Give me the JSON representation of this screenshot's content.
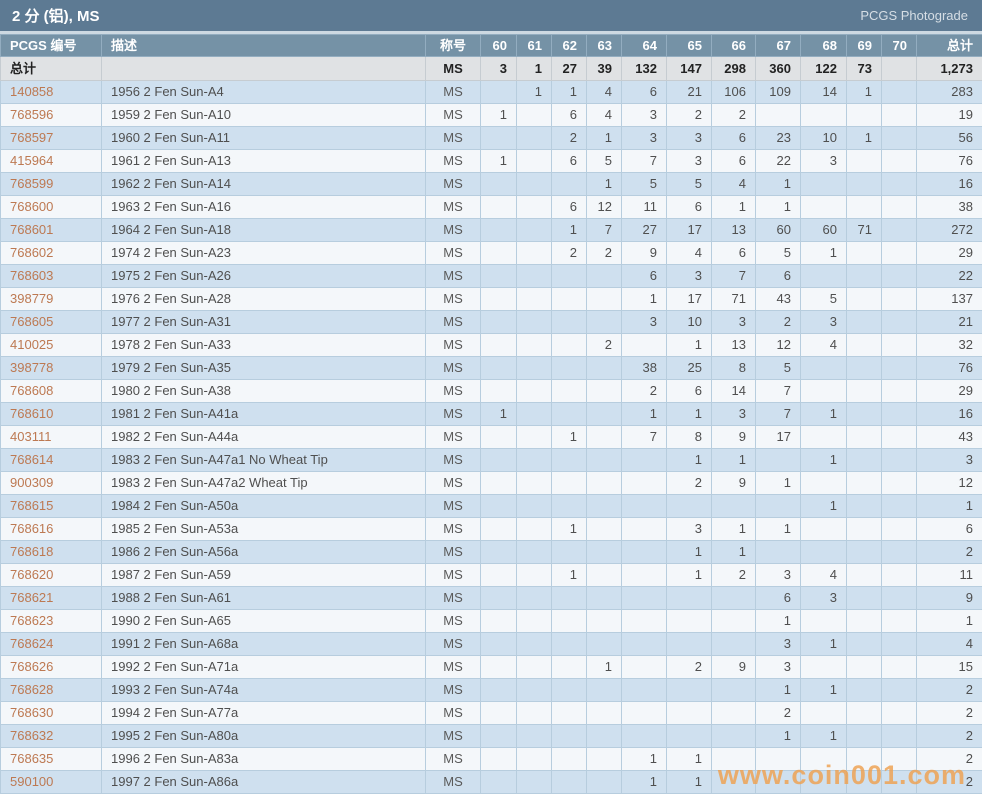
{
  "title_bar": {
    "title": "2 分 (铝), MS",
    "brand": "PCGS Photograde"
  },
  "table": {
    "headers": {
      "id": "PCGS 编号",
      "description": "描述",
      "designation": "称号",
      "grades": [
        "60",
        "61",
        "62",
        "63",
        "64",
        "65",
        "66",
        "67",
        "68",
        "69",
        "70"
      ],
      "total": "总计"
    },
    "totals_row": {
      "label": "总计",
      "designation": "MS",
      "values": [
        "3",
        "1",
        "27",
        "39",
        "132",
        "147",
        "298",
        "360",
        "122",
        "73",
        ""
      ],
      "total": "1,273"
    },
    "rows": [
      {
        "id": "140858",
        "description": "1956 2 Fen Sun-A4",
        "designation": "MS",
        "values": [
          "",
          "1",
          "1",
          "4",
          "6",
          "21",
          "106",
          "109",
          "14",
          "1",
          ""
        ],
        "total": "283"
      },
      {
        "id": "768596",
        "description": "1959 2 Fen Sun-A10",
        "designation": "MS",
        "values": [
          "1",
          "",
          "6",
          "4",
          "3",
          "2",
          "2",
          "",
          "",
          "",
          ""
        ],
        "total": "19"
      },
      {
        "id": "768597",
        "description": "1960 2 Fen Sun-A11",
        "designation": "MS",
        "values": [
          "",
          "",
          "2",
          "1",
          "3",
          "3",
          "6",
          "23",
          "10",
          "1",
          ""
        ],
        "total": "56"
      },
      {
        "id": "415964",
        "description": "1961 2 Fen Sun-A13",
        "designation": "MS",
        "values": [
          "1",
          "",
          "6",
          "5",
          "7",
          "3",
          "6",
          "22",
          "3",
          "",
          ""
        ],
        "total": "76"
      },
      {
        "id": "768599",
        "description": "1962 2 Fen Sun-A14",
        "designation": "MS",
        "values": [
          "",
          "",
          "",
          "1",
          "5",
          "5",
          "4",
          "1",
          "",
          "",
          ""
        ],
        "total": "16"
      },
      {
        "id": "768600",
        "description": "1963 2 Fen Sun-A16",
        "designation": "MS",
        "values": [
          "",
          "",
          "6",
          "12",
          "11",
          "6",
          "1",
          "1",
          "",
          "",
          ""
        ],
        "total": "38"
      },
      {
        "id": "768601",
        "description": "1964 2 Fen Sun-A18",
        "designation": "MS",
        "values": [
          "",
          "",
          "1",
          "7",
          "27",
          "17",
          "13",
          "60",
          "60",
          "71",
          ""
        ],
        "total": "272"
      },
      {
        "id": "768602",
        "description": "1974 2 Fen Sun-A23",
        "designation": "MS",
        "values": [
          "",
          "",
          "2",
          "2",
          "9",
          "4",
          "6",
          "5",
          "1",
          "",
          ""
        ],
        "total": "29"
      },
      {
        "id": "768603",
        "description": "1975 2 Fen Sun-A26",
        "designation": "MS",
        "values": [
          "",
          "",
          "",
          "",
          "6",
          "3",
          "7",
          "6",
          "",
          "",
          ""
        ],
        "total": "22"
      },
      {
        "id": "398779",
        "description": "1976 2 Fen Sun-A28",
        "designation": "MS",
        "values": [
          "",
          "",
          "",
          "",
          "1",
          "17",
          "71",
          "43",
          "5",
          "",
          ""
        ],
        "total": "137"
      },
      {
        "id": "768605",
        "description": "1977 2 Fen Sun-A31",
        "designation": "MS",
        "values": [
          "",
          "",
          "",
          "",
          "3",
          "10",
          "3",
          "2",
          "3",
          "",
          ""
        ],
        "total": "21"
      },
      {
        "id": "410025",
        "description": "1978 2 Fen Sun-A33",
        "designation": "MS",
        "values": [
          "",
          "",
          "",
          "2",
          "",
          "1",
          "13",
          "12",
          "4",
          "",
          ""
        ],
        "total": "32"
      },
      {
        "id": "398778",
        "description": "1979 2 Fen Sun-A35",
        "designation": "MS",
        "values": [
          "",
          "",
          "",
          "",
          "38",
          "25",
          "8",
          "5",
          "",
          "",
          ""
        ],
        "total": "76"
      },
      {
        "id": "768608",
        "description": "1980 2 Fen Sun-A38",
        "designation": "MS",
        "values": [
          "",
          "",
          "",
          "",
          "2",
          "6",
          "14",
          "7",
          "",
          "",
          ""
        ],
        "total": "29"
      },
      {
        "id": "768610",
        "description": "1981 2 Fen Sun-A41a",
        "designation": "MS",
        "values": [
          "1",
          "",
          "",
          "",
          "1",
          "1",
          "3",
          "7",
          "1",
          "",
          ""
        ],
        "total": "16"
      },
      {
        "id": "403111",
        "description": "1982 2 Fen Sun-A44a",
        "designation": "MS",
        "values": [
          "",
          "",
          "1",
          "",
          "7",
          "8",
          "9",
          "17",
          "",
          "",
          ""
        ],
        "total": "43"
      },
      {
        "id": "768614",
        "description": "1983 2 Fen Sun-A47a1 No Wheat Tip",
        "designation": "MS",
        "values": [
          "",
          "",
          "",
          "",
          "",
          "1",
          "1",
          "",
          "1",
          "",
          ""
        ],
        "total": "3"
      },
      {
        "id": "900309",
        "description": "1983 2 Fen Sun-A47a2 Wheat Tip",
        "designation": "MS",
        "values": [
          "",
          "",
          "",
          "",
          "",
          "2",
          "9",
          "1",
          "",
          "",
          ""
        ],
        "total": "12"
      },
      {
        "id": "768615",
        "description": "1984 2 Fen Sun-A50a",
        "designation": "MS",
        "values": [
          "",
          "",
          "",
          "",
          "",
          "",
          "",
          "",
          "1",
          "",
          ""
        ],
        "total": "1"
      },
      {
        "id": "768616",
        "description": "1985 2 Fen Sun-A53a",
        "designation": "MS",
        "values": [
          "",
          "",
          "1",
          "",
          "",
          "3",
          "1",
          "1",
          "",
          "",
          ""
        ],
        "total": "6"
      },
      {
        "id": "768618",
        "description": "1986 2 Fen Sun-A56a",
        "designation": "MS",
        "values": [
          "",
          "",
          "",
          "",
          "",
          "1",
          "1",
          "",
          "",
          "",
          ""
        ],
        "total": "2"
      },
      {
        "id": "768620",
        "description": "1987 2 Fen Sun-A59",
        "designation": "MS",
        "values": [
          "",
          "",
          "1",
          "",
          "",
          "1",
          "2",
          "3",
          "4",
          "",
          ""
        ],
        "total": "11"
      },
      {
        "id": "768621",
        "description": "1988 2 Fen Sun-A61",
        "designation": "MS",
        "values": [
          "",
          "",
          "",
          "",
          "",
          "",
          "",
          "6",
          "3",
          "",
          ""
        ],
        "total": "9"
      },
      {
        "id": "768623",
        "description": "1990 2 Fen Sun-A65",
        "designation": "MS",
        "values": [
          "",
          "",
          "",
          "",
          "",
          "",
          "",
          "1",
          "",
          "",
          ""
        ],
        "total": "1"
      },
      {
        "id": "768624",
        "description": "1991 2 Fen Sun-A68a",
        "designation": "MS",
        "values": [
          "",
          "",
          "",
          "",
          "",
          "",
          "",
          "3",
          "1",
          "",
          ""
        ],
        "total": "4"
      },
      {
        "id": "768626",
        "description": "1992 2 Fen Sun-A71a",
        "designation": "MS",
        "values": [
          "",
          "",
          "",
          "1",
          "",
          "2",
          "9",
          "3",
          "",
          "",
          ""
        ],
        "total": "15"
      },
      {
        "id": "768628",
        "description": "1993 2 Fen Sun-A74a",
        "designation": "MS",
        "values": [
          "",
          "",
          "",
          "",
          "",
          "",
          "",
          "1",
          "1",
          "",
          ""
        ],
        "total": "2"
      },
      {
        "id": "768630",
        "description": "1994 2 Fen Sun-A77a",
        "designation": "MS",
        "values": [
          "",
          "",
          "",
          "",
          "",
          "",
          "",
          "2",
          "",
          "",
          ""
        ],
        "total": "2"
      },
      {
        "id": "768632",
        "description": "1995 2 Fen Sun-A80a",
        "designation": "MS",
        "values": [
          "",
          "",
          "",
          "",
          "",
          "",
          "",
          "1",
          "1",
          "",
          ""
        ],
        "total": "2"
      },
      {
        "id": "768635",
        "description": "1996 2 Fen Sun-A83a",
        "designation": "MS",
        "values": [
          "",
          "",
          "",
          "",
          "1",
          "1",
          "",
          "",
          "",
          "",
          ""
        ],
        "total": "2"
      },
      {
        "id": "590100",
        "description": "1997 2 Fen Sun-A86a",
        "designation": "MS",
        "values": [
          "",
          "",
          "",
          "",
          "1",
          "1",
          "",
          "",
          "",
          "",
          ""
        ],
        "total": "2"
      }
    ]
  },
  "watermark": "www.coin001.com",
  "colors": {
    "title_bar_bg": "#5d7a93",
    "header_bg": "#7592a6",
    "totals_bg": "#e0e2e4",
    "row_blue": "#cfe0ef",
    "row_white": "#f4f7fa",
    "grid_border": "#b7cdde",
    "id_link": "#bd7952",
    "watermark_orange": "#eea04f"
  }
}
